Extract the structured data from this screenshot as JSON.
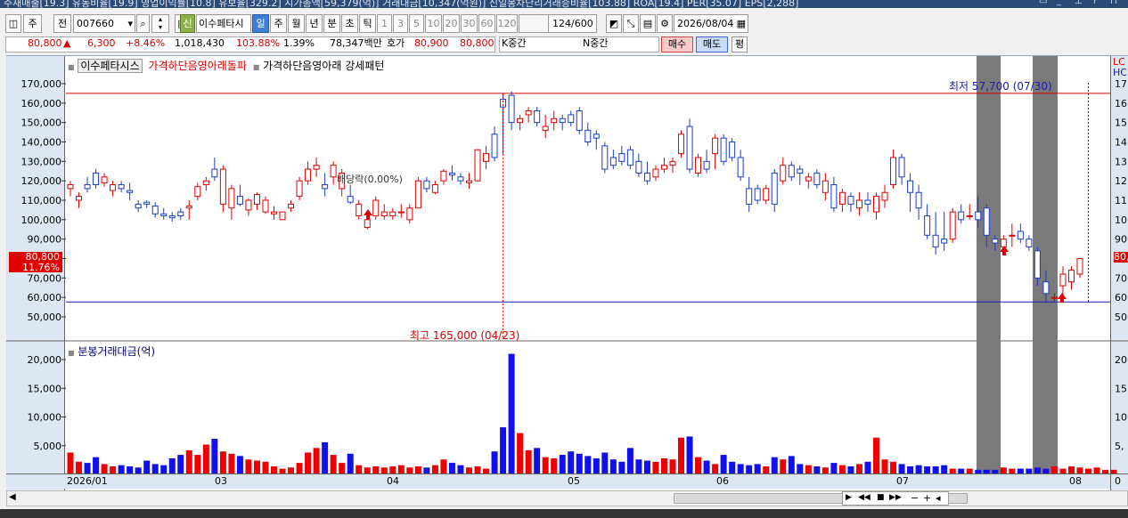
{
  "header": {
    "info_line": "주재매출[19.3]  유동비율[19.9]  영업이익률[10.8]  유보율[329.2]  시가총액[59,379(억)]  거래대금[10,347(억원)]  신일봉차단리거래증비율[103.88]  ROA[19.4]  PER[35.07]  EPS[2,288]"
  },
  "toolbar": {
    "buttons": [
      "주",
      "전"
    ],
    "stock_code": "007660",
    "stock_name": "이수페타시",
    "period_tabs": [
      "일",
      "주",
      "월",
      "년",
      "분",
      "초",
      "틱"
    ],
    "active_tab": "일",
    "intervals": [
      "1",
      "3",
      "5",
      "10",
      "20",
      "30",
      "60",
      "120"
    ],
    "count": "124",
    "total": "/600",
    "date": "2026/08/04",
    "sin_label": "신"
  },
  "quote": {
    "price": "80,800",
    "arrow": "▲",
    "change": "6,300",
    "change_pct": "+8.46%",
    "volume": "1,018,430",
    "vol_ratio": "103.88%",
    "turnover": "1.39%",
    "amount": "78,347백만",
    "hoga_label": "호가",
    "ask": "80,900",
    "bid": "80,800",
    "k_label": "K중간",
    "n_label": "N중간",
    "buy": "매수",
    "sell": "매도",
    "avg": "평"
  },
  "legend": {
    "name": "이수페타시스",
    "indicator1": "가격하단음영아래돌파",
    "indicator2": "가격하단음영아래 강세패턴",
    "volume_title": "분봉거래대금(억)"
  },
  "annotations": {
    "low": "최저 57,700 (07/30)",
    "high": "최고 165,000 (04/23)",
    "event": "배당락(0.00%)",
    "current_price": "80,800",
    "current_pct": "11.76%"
  },
  "chart_data": {
    "type": "candlestick",
    "price_ticks": [
      "170,000",
      "160,000",
      "150,000",
      "140,000",
      "130,000",
      "120,000",
      "110,000",
      "100,000",
      "90,000",
      "80,000",
      "70,000",
      "60,000",
      "50,000"
    ],
    "right_ticks": [
      "17",
      "16",
      "15",
      "14",
      "13",
      "12",
      "11",
      "10",
      "90",
      "80",
      "70",
      "60",
      "50"
    ],
    "right_labels": [
      "LC",
      "HC"
    ],
    "volume_ticks": [
      "20,000",
      "15,000",
      "10,000",
      "5,000"
    ],
    "right_volume_ticks": [
      "20",
      "15",
      "10",
      "5,"
    ],
    "x_labels": [
      "2026/01",
      "03",
      "04",
      "05",
      "06",
      "07",
      "08"
    ],
    "candles": [
      [
        116,
        120,
        112,
        118
      ],
      [
        110,
        114,
        106,
        112
      ],
      [
        118,
        122,
        114,
        116
      ],
      [
        124,
        126,
        116,
        118
      ],
      [
        119,
        124,
        117,
        122
      ],
      [
        115,
        120,
        112,
        118
      ],
      [
        118,
        120,
        114,
        116
      ],
      [
        115,
        119,
        110,
        114
      ],
      [
        108,
        110,
        104,
        106
      ],
      [
        109,
        110,
        106,
        108
      ],
      [
        107,
        109,
        101,
        103
      ],
      [
        103,
        106,
        100,
        102
      ],
      [
        102,
        104,
        99,
        101
      ],
      [
        104,
        106,
        100,
        102
      ],
      [
        106,
        110,
        100,
        107
      ],
      [
        112,
        119,
        110,
        117
      ],
      [
        118,
        122,
        115,
        120
      ],
      [
        126,
        132,
        120,
        122
      ],
      [
        108,
        128,
        104,
        126
      ],
      [
        106,
        118,
        100,
        116
      ],
      [
        112,
        118,
        107,
        108
      ],
      [
        105,
        111,
        102,
        110
      ],
      [
        108,
        114,
        105,
        113
      ],
      [
        104,
        112,
        103,
        110
      ],
      [
        103,
        107,
        100,
        104
      ],
      [
        100,
        104,
        100,
        104
      ],
      [
        106,
        110,
        104,
        108
      ],
      [
        112,
        122,
        110,
        120
      ],
      [
        120,
        130,
        118,
        126
      ],
      [
        126,
        132,
        122,
        128
      ],
      [
        118,
        124,
        112,
        116
      ],
      [
        122,
        130,
        118,
        128
      ],
      [
        116,
        126,
        112,
        124
      ],
      [
        112,
        118,
        108,
        109
      ],
      [
        102,
        110,
        100,
        108
      ],
      [
        96,
        102,
        95,
        100
      ],
      [
        102,
        112,
        100,
        110
      ],
      [
        102,
        108,
        100,
        104
      ],
      [
        102,
        106,
        100,
        104
      ],
      [
        104,
        108,
        101,
        104
      ],
      [
        100,
        108,
        98,
        106
      ],
      [
        106,
        122,
        106,
        120
      ],
      [
        120,
        122,
        114,
        116
      ],
      [
        114,
        120,
        113,
        118
      ],
      [
        120,
        126,
        118,
        125
      ],
      [
        124,
        128,
        120,
        123
      ],
      [
        122,
        124,
        118,
        120
      ],
      [
        119,
        124,
        116,
        120
      ],
      [
        120,
        136,
        120,
        136
      ],
      [
        130,
        138,
        126,
        134
      ],
      [
        144,
        148,
        130,
        132
      ],
      [
        162,
        165,
        134,
        158
      ],
      [
        164,
        166,
        146,
        150
      ],
      [
        150,
        154,
        146,
        152
      ],
      [
        154,
        158,
        150,
        156
      ],
      [
        156,
        158,
        148,
        150
      ],
      [
        146,
        154,
        142,
        148
      ],
      [
        150,
        156,
        146,
        152
      ],
      [
        152,
        154,
        146,
        150
      ],
      [
        154,
        156,
        148,
        150
      ],
      [
        156,
        158,
        144,
        146
      ],
      [
        146,
        150,
        138,
        140
      ],
      [
        144,
        146,
        136,
        142
      ],
      [
        138,
        140,
        124,
        126
      ],
      [
        132,
        136,
        126,
        128
      ],
      [
        134,
        138,
        128,
        130
      ],
      [
        136,
        138,
        126,
        128
      ],
      [
        130,
        134,
        122,
        124
      ],
      [
        124,
        130,
        118,
        120
      ],
      [
        122,
        128,
        120,
        126
      ],
      [
        126,
        132,
        124,
        128
      ],
      [
        128,
        132,
        124,
        130
      ],
      [
        134,
        146,
        132,
        144
      ],
      [
        148,
        152,
        124,
        126
      ],
      [
        124,
        134,
        122,
        132
      ],
      [
        130,
        136,
        124,
        126
      ],
      [
        134,
        144,
        126,
        142
      ],
      [
        142,
        144,
        128,
        130
      ],
      [
        140,
        142,
        130,
        132
      ],
      [
        132,
        136,
        120,
        122
      ],
      [
        116,
        122,
        104,
        108
      ],
      [
        116,
        118,
        108,
        110
      ],
      [
        110,
        118,
        108,
        116
      ],
      [
        124,
        126,
        104,
        108
      ],
      [
        120,
        132,
        118,
        128
      ],
      [
        128,
        130,
        120,
        122
      ],
      [
        126,
        128,
        118,
        124
      ],
      [
        120,
        124,
        116,
        122
      ],
      [
        124,
        126,
        116,
        118
      ],
      [
        114,
        124,
        110,
        120
      ],
      [
        118,
        122,
        104,
        106
      ],
      [
        108,
        116,
        104,
        114
      ],
      [
        112,
        114,
        104,
        108
      ],
      [
        106,
        114,
        102,
        110
      ],
      [
        110,
        114,
        104,
        108
      ],
      [
        104,
        114,
        100,
        112
      ],
      [
        110,
        118,
        106,
        114
      ],
      [
        118,
        136,
        116,
        132
      ],
      [
        132,
        134,
        118,
        122
      ],
      [
        120,
        124,
        104,
        114
      ],
      [
        114,
        118,
        100,
        106
      ],
      [
        102,
        108,
        90,
        92
      ],
      [
        92,
        104,
        82,
        86
      ],
      [
        90,
        104,
        84,
        88
      ],
      [
        90,
        106,
        88,
        104
      ],
      [
        104,
        108,
        98,
        100
      ],
      [
        102,
        108,
        100,
        102
      ],
      [
        104,
        112,
        96,
        100
      ],
      [
        106,
        108,
        86,
        92
      ],
      [
        90,
        92,
        84,
        88
      ],
      [
        86,
        92,
        84,
        90
      ],
      [
        92,
        98,
        86,
        92
      ],
      [
        94,
        98,
        88,
        90
      ],
      [
        90,
        92,
        84,
        86
      ],
      [
        84,
        86,
        66,
        70
      ],
      [
        68,
        74,
        58,
        62
      ],
      [
        60,
        62,
        58,
        60
      ],
      [
        66,
        76,
        58,
        72
      ],
      [
        68,
        76,
        64,
        74
      ],
      [
        72,
        80,
        70,
        80
      ]
    ],
    "volumes": [
      38,
      22,
      20,
      30,
      18,
      14,
      16,
      14,
      12,
      24,
      18,
      16,
      28,
      34,
      42,
      34,
      52,
      62,
      40,
      36,
      32,
      26,
      24,
      22,
      14,
      10,
      12,
      20,
      38,
      46,
      56,
      34,
      20,
      36,
      16,
      12,
      14,
      12,
      14,
      16,
      12,
      14,
      12,
      16,
      26,
      20,
      16,
      12,
      14,
      10,
      40,
      82,
      210,
      72,
      42,
      46,
      30,
      28,
      34,
      40,
      36,
      32,
      28,
      38,
      26,
      22,
      46,
      26,
      24,
      22,
      28,
      26,
      64,
      66,
      30,
      24,
      18,
      34,
      22,
      18,
      16,
      18,
      14,
      30,
      26,
      32,
      18,
      16,
      14,
      12,
      20,
      16,
      14,
      18,
      22,
      64,
      26,
      22,
      18,
      14,
      16,
      14,
      14,
      16,
      10,
      10,
      10,
      8,
      8,
      8,
      12,
      10,
      10,
      10,
      12,
      10,
      14,
      10,
      14,
      12,
      10,
      12,
      8,
      8
    ],
    "high_value": "165,000",
    "low_value": "57,700"
  }
}
